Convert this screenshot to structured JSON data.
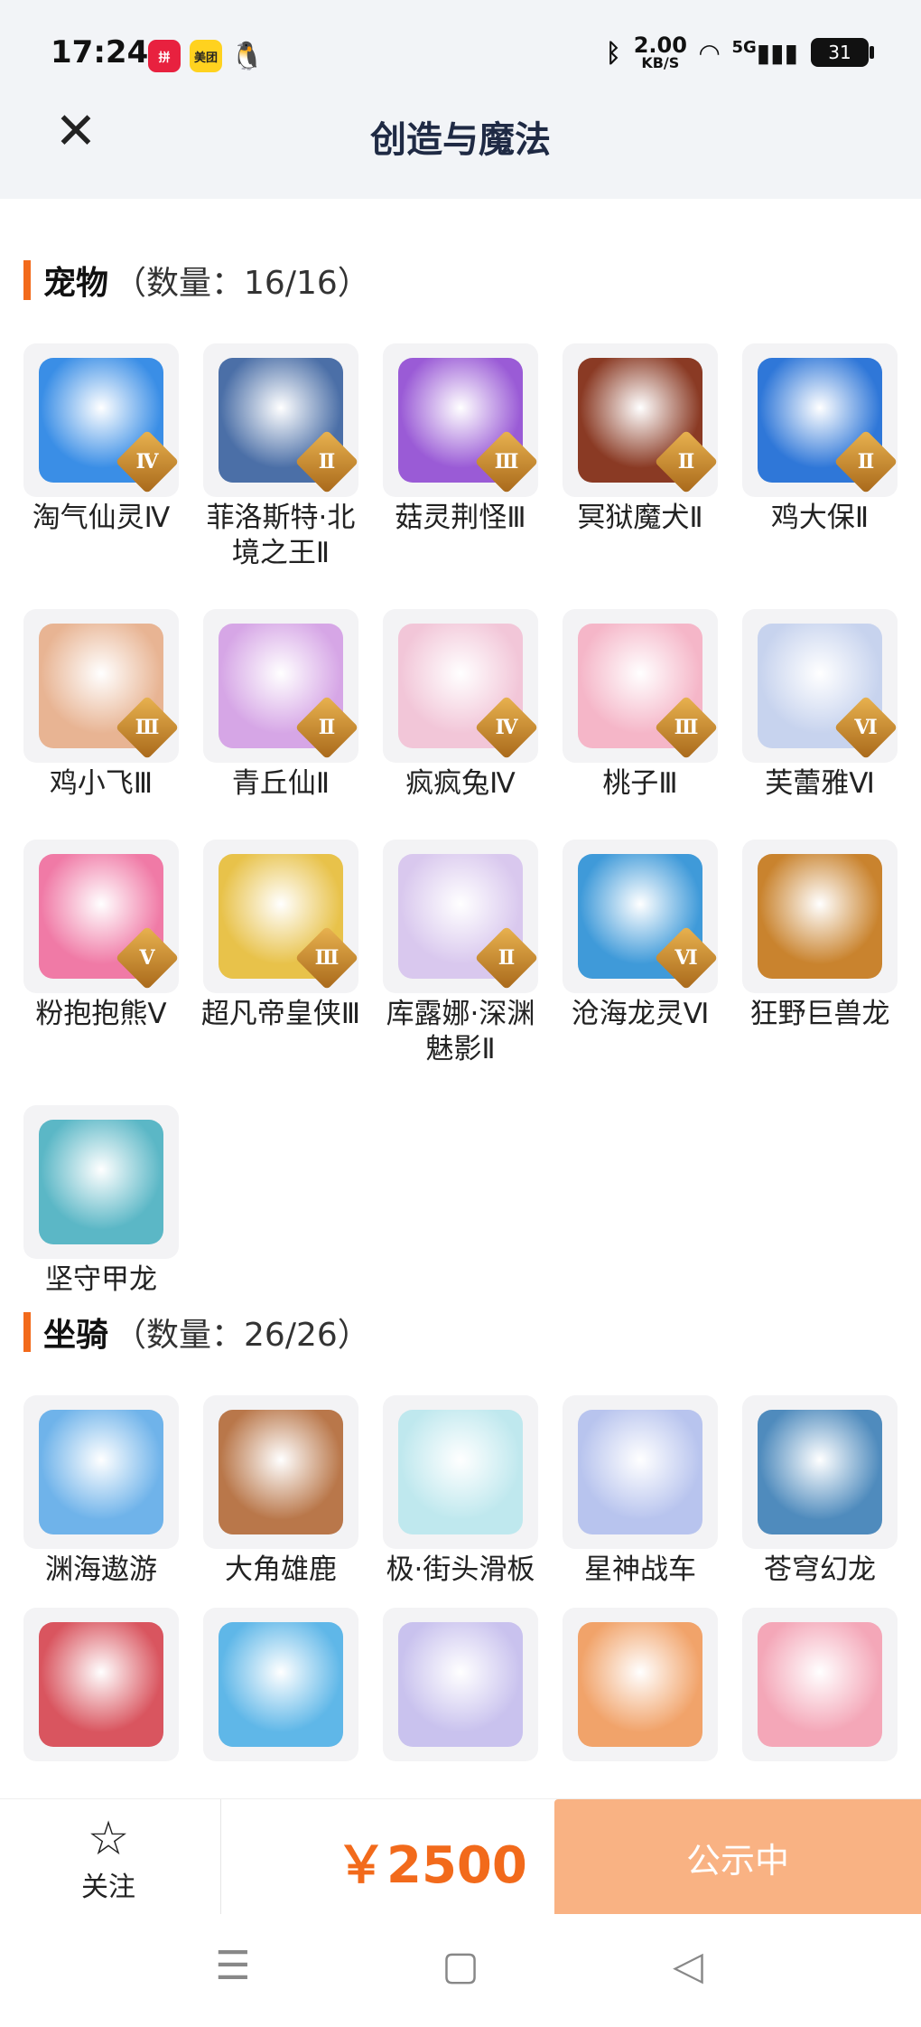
{
  "status": {
    "time": "17:24",
    "apps": [
      "拼",
      "美团",
      "🐧"
    ],
    "net_speed_value": "2.00",
    "net_speed_unit": "KB/S",
    "network": "5G",
    "battery": "31"
  },
  "header": {
    "title": "创造与魔法",
    "back_icon": "close-icon"
  },
  "pets": {
    "name": "宠物",
    "count": "（数量：16/16）",
    "items": [
      {
        "label": "淘气仙灵Ⅳ",
        "rank": "Ⅳ",
        "color": "#3a8ee6"
      },
      {
        "label": "菲洛斯特·北境之王Ⅱ",
        "rank": "Ⅱ",
        "color": "#4b6fa7"
      },
      {
        "label": "菇灵荆怪Ⅲ",
        "rank": "Ⅲ",
        "color": "#9a5bd6"
      },
      {
        "label": "冥狱魔犬Ⅱ",
        "rank": "Ⅱ",
        "color": "#8a3a24"
      },
      {
        "label": "鸡大保Ⅱ",
        "rank": "Ⅱ",
        "color": "#2f77d8"
      },
      {
        "label": "鸡小飞Ⅲ",
        "rank": "Ⅲ",
        "color": "#e8b493"
      },
      {
        "label": "青丘仙Ⅱ",
        "rank": "Ⅱ",
        "color": "#d6a6e6"
      },
      {
        "label": "疯疯兔Ⅳ",
        "rank": "Ⅳ",
        "color": "#f2c6d8"
      },
      {
        "label": "桃子Ⅲ",
        "rank": "Ⅲ",
        "color": "#f5b6c8"
      },
      {
        "label": "芙蕾雅Ⅵ",
        "rank": "Ⅵ",
        "color": "#c7d3ee"
      },
      {
        "label": "粉抱抱熊Ⅴ",
        "rank": "Ⅴ",
        "color": "#f07aa6"
      },
      {
        "label": "超凡帝皇侠Ⅲ",
        "rank": "Ⅲ",
        "color": "#e8c24a"
      },
      {
        "label": "库露娜·深渊魅影Ⅱ",
        "rank": "Ⅱ",
        "color": "#d9c8ee"
      },
      {
        "label": "沧海龙灵Ⅵ",
        "rank": "Ⅵ",
        "color": "#3f9ad9"
      },
      {
        "label": "狂野巨兽龙",
        "rank": "",
        "color": "#c9832e"
      },
      {
        "label": "坚守甲龙",
        "rank": "",
        "color": "#5bb7c6"
      }
    ]
  },
  "mounts": {
    "name": "坐骑",
    "count": "（数量：26/26）",
    "items": [
      {
        "label": "渊海遨游",
        "color": "#6fb3ea"
      },
      {
        "label": "大角雄鹿",
        "color": "#b9774a"
      },
      {
        "label": "极·街头滑板",
        "color": "#bfe8ee"
      },
      {
        "label": "星神战车",
        "color": "#b8c4ee"
      },
      {
        "label": "苍穹幻龙",
        "color": "#4f8bbd"
      },
      {
        "label": "",
        "color": "#d9555f"
      },
      {
        "label": "",
        "color": "#5fb7e8"
      },
      {
        "label": "",
        "color": "#c9c2ee"
      },
      {
        "label": "",
        "color": "#f1a36a"
      },
      {
        "label": "",
        "color": "#f4a7b8"
      }
    ]
  },
  "bottom": {
    "follow_label": "关注",
    "price": "￥2500",
    "status_button": "公示中"
  }
}
